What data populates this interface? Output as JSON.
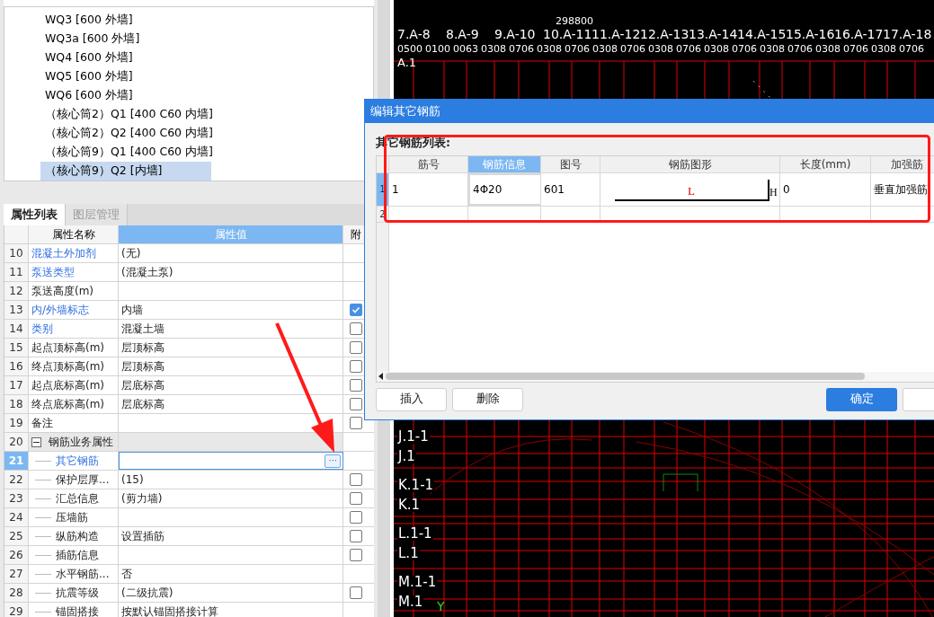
{
  "tree": {
    "items": [
      {
        "label": "WQ3 [600 外墙]",
        "selected": false
      },
      {
        "label": "WQ3a [600 外墙]",
        "selected": false
      },
      {
        "label": "WQ4 [600 外墙]",
        "selected": false
      },
      {
        "label": "WQ5 [600 外墙]",
        "selected": false
      },
      {
        "label": "WQ6 [600 外墙]",
        "selected": false
      },
      {
        "label": "（核心筒2）Q1 [400 C60 内墙]",
        "selected": false
      },
      {
        "label": "（核心筒2）Q2 [400 C60 内墙]",
        "selected": false
      },
      {
        "label": "（核心筒9）Q1 [400 C60 内墙]",
        "selected": false
      },
      {
        "label": "（核心筒9）Q2 [内墙]",
        "selected": true
      }
    ]
  },
  "panel_tabs": [
    {
      "label": "属性列表",
      "selected": true
    },
    {
      "label": "图层管理",
      "selected": false
    }
  ],
  "properties": {
    "columns": [
      "属性名称",
      "属性值",
      "附"
    ],
    "rows": [
      {
        "num": "10",
        "name": "混凝土外加剂",
        "value": "(无)",
        "link": true,
        "selected": false
      },
      {
        "num": "11",
        "name": "泵送类型",
        "value": "(混凝土泵)",
        "link": true,
        "selected": false
      },
      {
        "num": "12",
        "name": "泵送高度(m)",
        "value": "",
        "link": false,
        "selected": false
      },
      {
        "num": "13",
        "name": "内/外墙标志",
        "value": "内墙",
        "link": true,
        "checked": true,
        "selected": false
      },
      {
        "num": "14",
        "name": "类别",
        "value": "混凝土墙",
        "link": true,
        "checked": false,
        "selected": false
      },
      {
        "num": "15",
        "name": "起点顶标高(m)",
        "value": "层顶标高",
        "link": false,
        "checked": false,
        "selected": false
      },
      {
        "num": "16",
        "name": "终点顶标高(m)",
        "value": "层顶标高",
        "link": false,
        "checked": false,
        "selected": false
      },
      {
        "num": "17",
        "name": "起点底标高(m)",
        "value": "层底标高",
        "link": false,
        "checked": false,
        "selected": false
      },
      {
        "num": "18",
        "name": "终点底标高(m)",
        "value": "层底标高",
        "link": false,
        "checked": false,
        "selected": false
      },
      {
        "num": "19",
        "name": "备注",
        "value": "",
        "link": false,
        "checked": false,
        "selected": false
      },
      {
        "num": "20",
        "name": "钢筋业务属性",
        "value": "",
        "link": false,
        "selected": false,
        "expanded": true,
        "children": [
          {
            "num": "21",
            "name": "其它钢筋",
            "link": true,
            "selected": true,
            "ellipsis": "···"
          },
          {
            "num": "22",
            "name": "保护层厚...",
            "value": "(15)",
            "link": false,
            "checked": false,
            "selected": false
          },
          {
            "num": "23",
            "name": "汇总信息",
            "value": "(剪力墙)",
            "link": false,
            "checked": false,
            "selected": false
          },
          {
            "num": "24",
            "name": "压墙筋",
            "link": false,
            "checked": false,
            "selected": false
          },
          {
            "num": "25",
            "name": "纵筋构造",
            "value": "设置插筋",
            "link": false,
            "checked": false,
            "selected": false
          },
          {
            "num": "26",
            "name": "插筋信息",
            "link": false,
            "checked": false,
            "selected": false
          },
          {
            "num": "27",
            "name": "水平钢筋...",
            "value": "否",
            "link": false,
            "selected": false
          },
          {
            "num": "28",
            "name": "抗震等级",
            "value": "(二级抗震)",
            "link": false,
            "checked": false,
            "selected": false
          },
          {
            "num": "29",
            "name": "锚固搭接",
            "value": "按默认锚固搭接计算",
            "link": false,
            "selected": false
          }
        ]
      }
    ]
  },
  "cad": {
    "top_labels": [
      "7.A-8",
      "8.A-9",
      "9.A-10",
      "10.A-11",
      "11.A-12",
      "12.A-13",
      "13.A-14",
      "14.A-15",
      "15.A-16",
      "16.A-17",
      "17.A-18"
    ],
    "top_numbers": [
      "0500",
      "0100",
      "0063",
      "0308",
      "0706",
      "0308",
      "0706",
      "0308",
      "0706",
      "0308",
      "0706",
      "0308",
      "0706",
      "0308",
      "0706",
      "0308",
      "0706",
      "0308",
      "0706"
    ],
    "corner_label": "A.1",
    "dimension": "298800",
    "side_labels": [
      "J.1-1",
      "J.1",
      "K.1-1",
      "K.1",
      "L.1-1",
      "L.1",
      "M.1-1",
      "M.1"
    ],
    "axis": "Y"
  },
  "dialog": {
    "title": "编辑其它钢筋",
    "list_label": "其它钢筋列表:",
    "columns": [
      {
        "label": "筋号",
        "selected": false
      },
      {
        "label": "钢筋信息",
        "selected": true
      },
      {
        "label": "图号",
        "selected": false
      },
      {
        "label": "钢筋图形",
        "selected": false
      },
      {
        "label": "长度(mm)",
        "selected": false
      },
      {
        "label": "加强筋",
        "selected": false
      }
    ],
    "rows": [
      {
        "num": "1",
        "selected": true,
        "cells": [
          "1",
          "4Φ20",
          "601",
          "",
          "0",
          "垂直加强筋"
        ],
        "shape": {
          "length_label": "L",
          "height_label": "H"
        }
      },
      {
        "num": "2",
        "selected": false,
        "cells": [
          "",
          "",
          "",
          "",
          "",
          ""
        ]
      }
    ],
    "buttons": [
      {
        "label": "插入"
      },
      {
        "label": "删除"
      }
    ],
    "ok": "确定"
  }
}
